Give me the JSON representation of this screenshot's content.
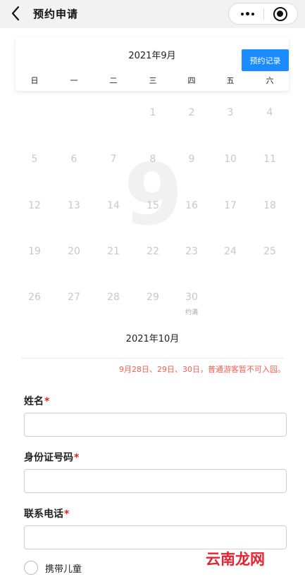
{
  "navbar": {
    "title": "预约申请",
    "back_icon": "chevron-left-icon",
    "more_icon": "more-dots-icon",
    "close_icon": "target-close-icon"
  },
  "calendar": {
    "month_title": "2021年9月",
    "record_button": "预约记录",
    "accent_color": "#1a8cff",
    "weekdays": [
      "日",
      "一",
      "二",
      "三",
      "四",
      "五",
      "六"
    ],
    "watermark": "9",
    "weeks": [
      [
        "",
        "",
        "",
        "1",
        "2",
        "3",
        "4"
      ],
      [
        "5",
        "6",
        "7",
        "8",
        "9",
        "10",
        "11"
      ],
      [
        "12",
        "13",
        "14",
        "15",
        "16",
        "17",
        "18"
      ],
      [
        "19",
        "20",
        "21",
        "22",
        "23",
        "24",
        "25"
      ],
      [
        "26",
        "27",
        "28",
        "29",
        "30",
        "",
        ""
      ]
    ],
    "day_30_note": "约满",
    "next_month_title": "2021年10月"
  },
  "notice": {
    "text": "9月28日、29日、30日，普通游客暂不可入园。",
    "color": "#ff5c4d"
  },
  "form": {
    "name_label": "姓名",
    "id_label": "身份证号码",
    "phone_label": "联系电话",
    "required_mark": "*",
    "child_option": "携带儿童"
  },
  "brand": {
    "text": "云南龙网"
  }
}
